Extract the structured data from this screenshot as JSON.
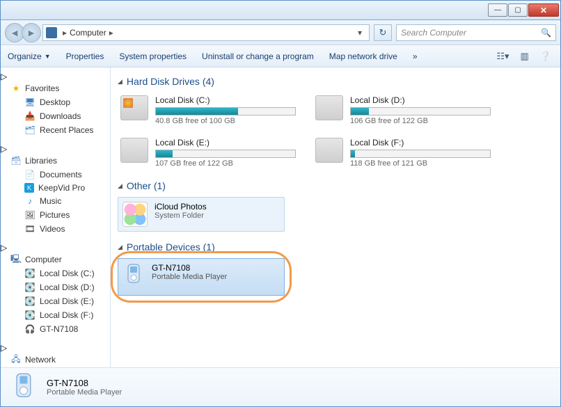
{
  "titlebar": {
    "minimize": "—",
    "maximize": "▢",
    "close": "✕"
  },
  "address": {
    "root": "Computer",
    "sep": "▸"
  },
  "search": {
    "placeholder": "Search Computer"
  },
  "toolbar": {
    "organize": "Organize",
    "properties": "Properties",
    "system_properties": "System properties",
    "uninstall": "Uninstall or change a program",
    "map_drive": "Map network drive",
    "more": "»"
  },
  "sidebar": {
    "favorites": {
      "label": "Favorites",
      "items": [
        "Desktop",
        "Downloads",
        "Recent Places"
      ]
    },
    "libraries": {
      "label": "Libraries",
      "items": [
        "Documents",
        "KeepVid Pro",
        "Music",
        "Pictures",
        "Videos"
      ]
    },
    "computer": {
      "label": "Computer",
      "items": [
        "Local Disk (C:)",
        "Local Disk (D:)",
        "Local Disk (E:)",
        "Local Disk (F:)",
        "GT-N7108"
      ]
    },
    "network": {
      "label": "Network"
    }
  },
  "groups": {
    "hdd": {
      "title": "Hard Disk Drives (4)",
      "drives": [
        {
          "name": "Local Disk (C:)",
          "free": "40.8 GB free of 100 GB",
          "pct": 59,
          "sys": true
        },
        {
          "name": "Local Disk (D:)",
          "free": "106 GB free of 122 GB",
          "pct": 13,
          "sys": false
        },
        {
          "name": "Local Disk (E:)",
          "free": "107 GB free of 122 GB",
          "pct": 12,
          "sys": false
        },
        {
          "name": "Local Disk (F:)",
          "free": "118 GB free of 121 GB",
          "pct": 3,
          "sys": false
        }
      ]
    },
    "other": {
      "title": "Other (1)",
      "item": {
        "name": "iCloud Photos",
        "desc": "System Folder"
      }
    },
    "portable": {
      "title": "Portable Devices (1)",
      "item": {
        "name": "GT-N7108",
        "desc": "Portable Media Player"
      }
    }
  },
  "details": {
    "name": "GT-N7108",
    "desc": "Portable Media Player"
  }
}
